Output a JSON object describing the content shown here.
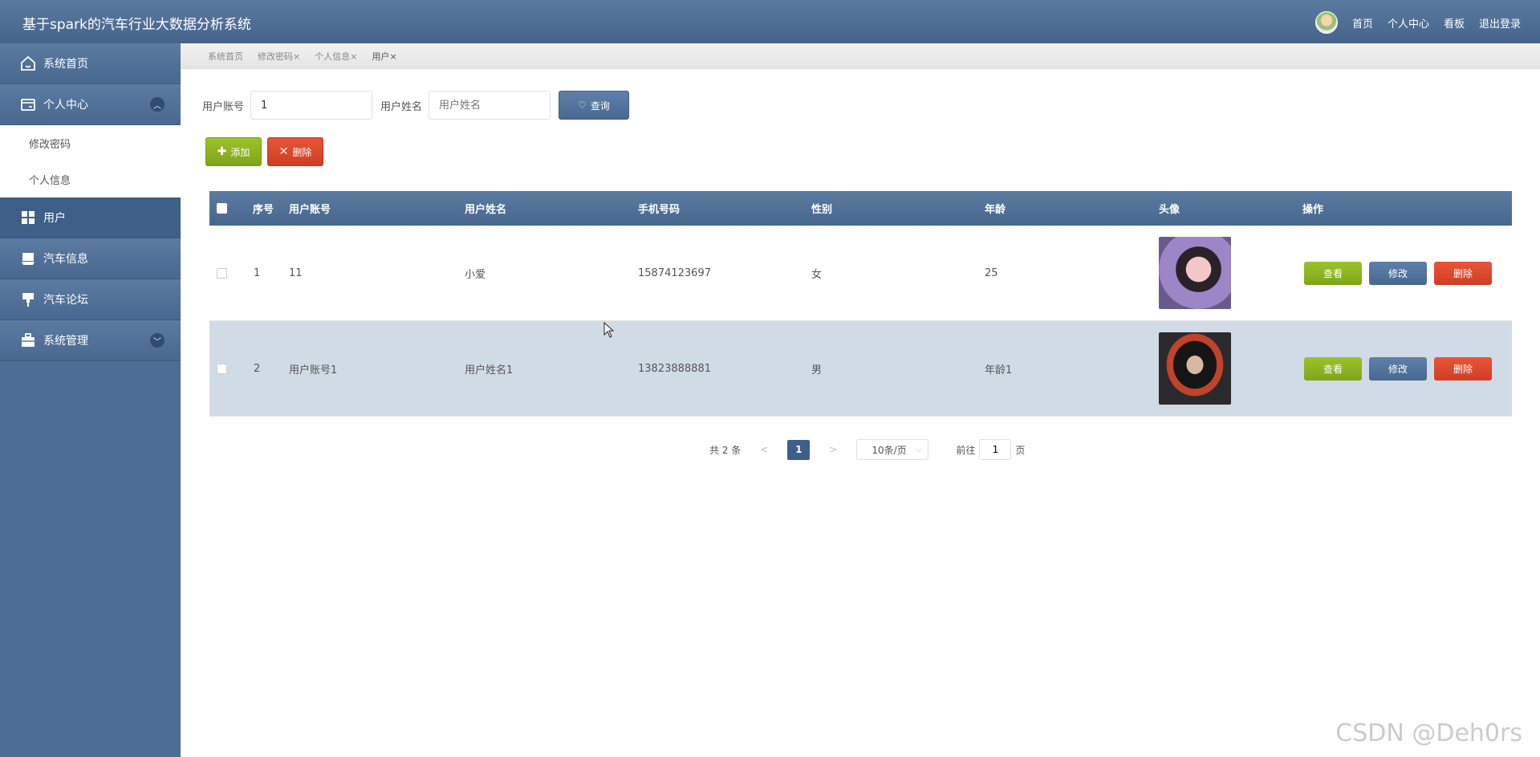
{
  "header": {
    "title": "基于spark的汽车行业大数据分析系统",
    "links": [
      "首页",
      "个人中心",
      "看板",
      "退出登录"
    ]
  },
  "sidebar": {
    "items": [
      {
        "label": "系统首页",
        "icon": "home-icon"
      },
      {
        "label": "个人中心",
        "icon": "card-icon",
        "expanded": true,
        "children": [
          "修改密码",
          "个人信息"
        ]
      },
      {
        "label": "用户",
        "icon": "grid-icon",
        "active": true
      },
      {
        "label": "汽车信息",
        "icon": "tray-icon"
      },
      {
        "label": "汽车论坛",
        "icon": "pin-icon"
      },
      {
        "label": "系统管理",
        "icon": "briefcase-icon",
        "expanded": false
      }
    ]
  },
  "tags": [
    {
      "label": "系统首页"
    },
    {
      "label": "修改密码",
      "close": "×"
    },
    {
      "label": "个人信息",
      "close": "×"
    },
    {
      "label": "用户",
      "close": "×"
    }
  ],
  "search": {
    "account_label": "用户账号",
    "account_value": "1",
    "name_label": "用户姓名",
    "name_placeholder": "用户姓名",
    "query_label": "查询"
  },
  "actions": {
    "add_label": "添加",
    "delete_label": "删除"
  },
  "table": {
    "columns": [
      "序号",
      "用户账号",
      "用户姓名",
      "手机号码",
      "性别",
      "年龄",
      "头像",
      "操作"
    ],
    "rows": [
      {
        "index": "1",
        "account": "11",
        "name": "小爱",
        "phone": "15874123697",
        "gender": "女",
        "age": "25"
      },
      {
        "index": "2",
        "account": "用户账号1",
        "name": "用户姓名1",
        "phone": "13823888881",
        "gender": "男",
        "age": "年龄1"
      }
    ],
    "ops": {
      "view": "查看",
      "edit": "修改",
      "delete": "删除"
    }
  },
  "pager": {
    "total": "共 2 条",
    "prev": "<",
    "current": "1",
    "next": ">",
    "page_size": "10条/页",
    "goto_label": "前往",
    "goto_value": "1",
    "page_suffix": "页"
  },
  "watermark": "CSDN @Deh0rs"
}
